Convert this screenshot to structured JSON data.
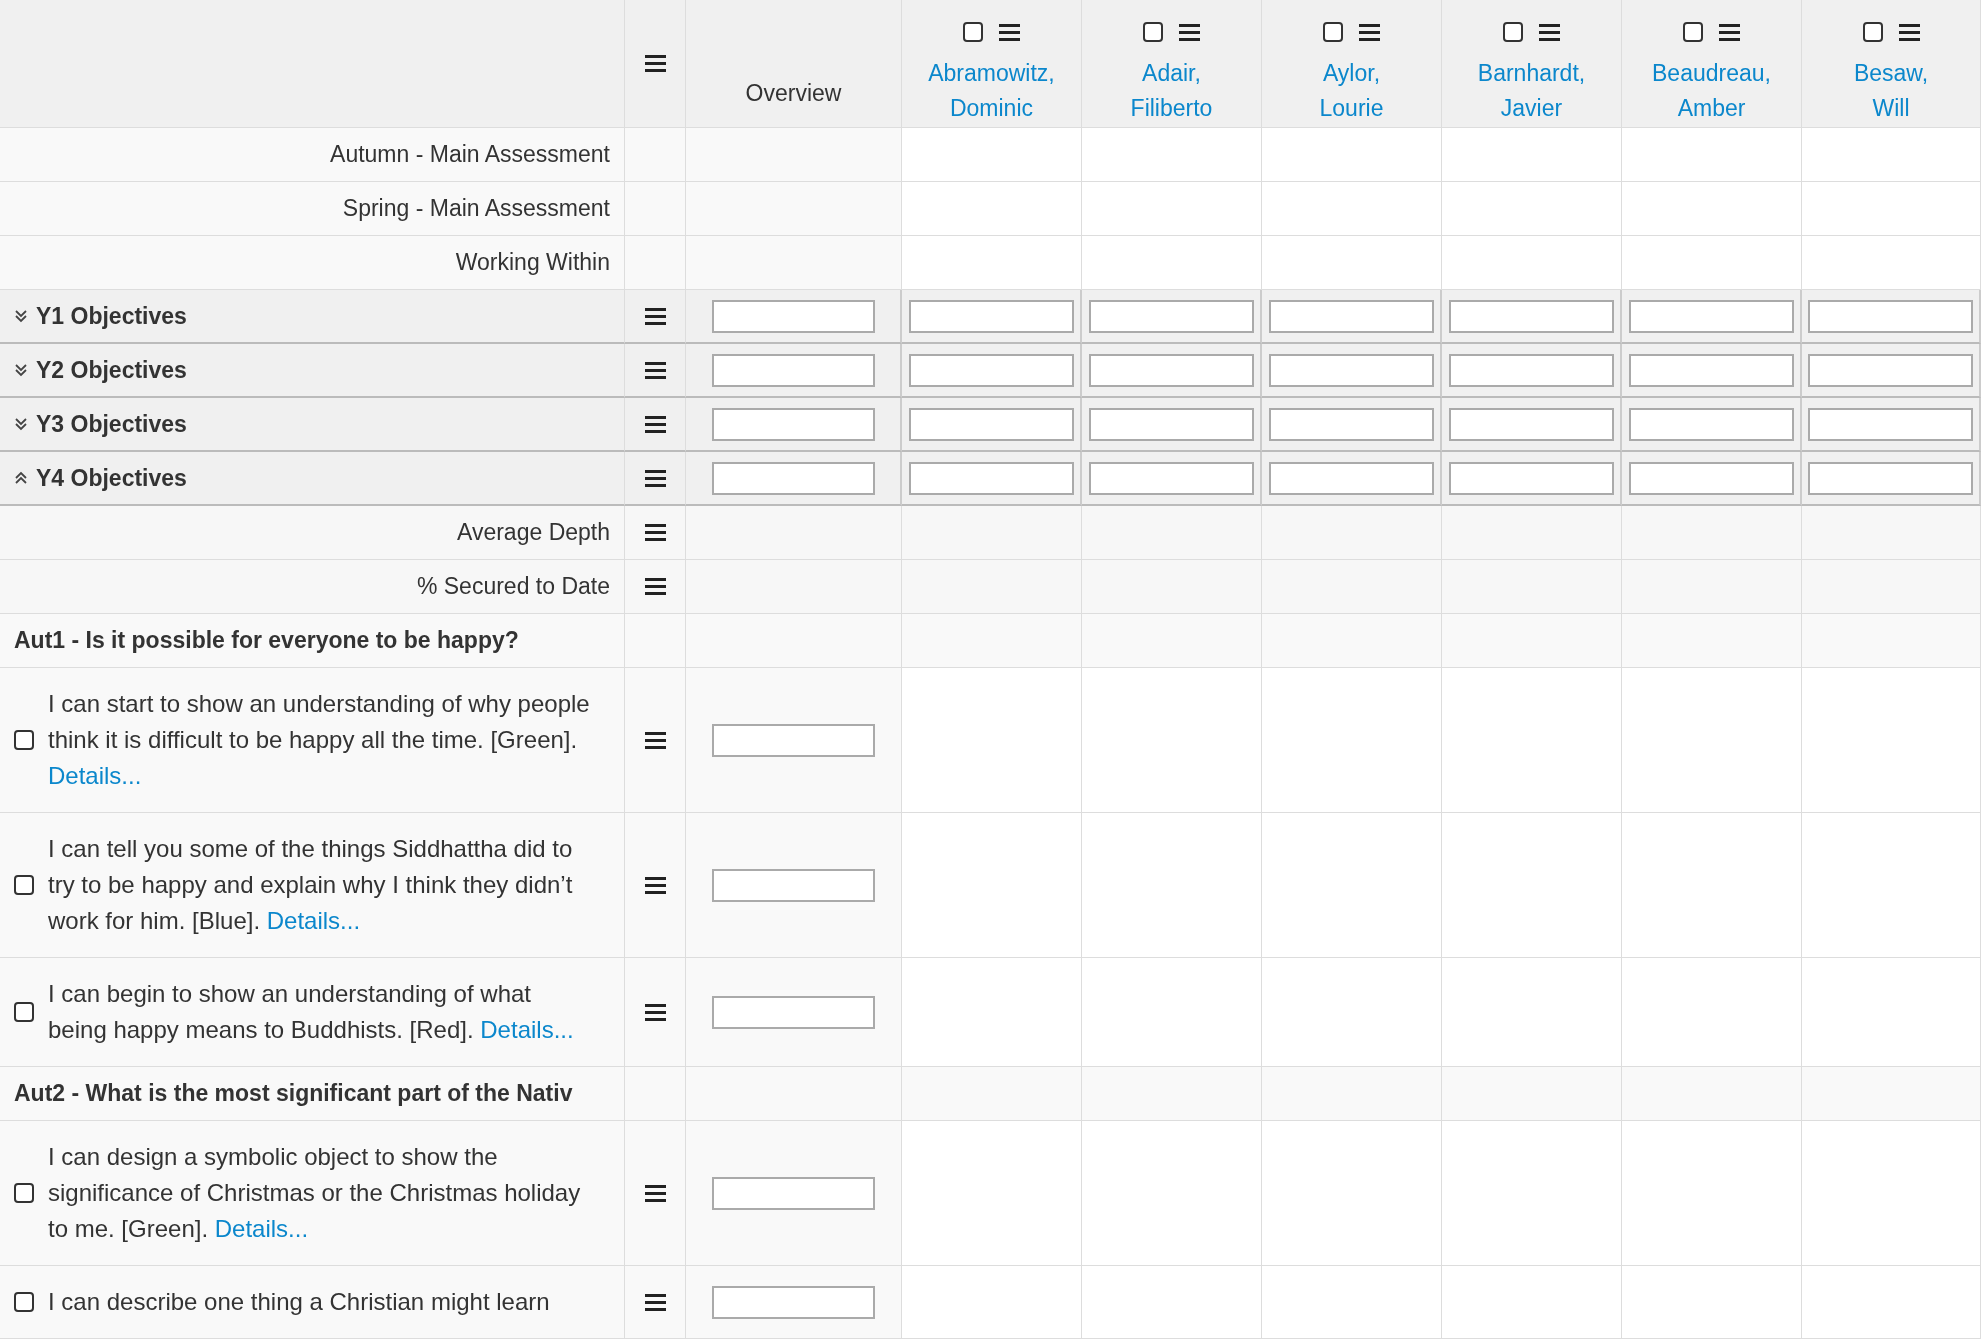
{
  "header": {
    "overview": "Overview",
    "students": [
      {
        "last": "Abramowitz,",
        "first": "Dominic",
        "checked": false
      },
      {
        "last": "Adair,",
        "first": "Filiberto",
        "checked": false
      },
      {
        "last": "Aylor,",
        "first": "Lourie",
        "checked": false
      },
      {
        "last": "Barnhardt,",
        "first": "Javier",
        "checked": false
      },
      {
        "last": "Beaudreau,",
        "first": "Amber",
        "checked": false
      },
      {
        "last": "Besaw,",
        "first": "Will",
        "checked": false
      }
    ]
  },
  "rows": [
    {
      "kind": "assessment",
      "label": "Autumn - Main Assessment"
    },
    {
      "kind": "assessment",
      "label": "Spring - Main Assessment"
    },
    {
      "kind": "assessment",
      "label": "Working Within"
    },
    {
      "kind": "group",
      "label": "Y1 Objectives",
      "expanded": false
    },
    {
      "kind": "group",
      "label": "Y2 Objectives",
      "expanded": false
    },
    {
      "kind": "group",
      "label": "Y3 Objectives",
      "expanded": false
    },
    {
      "kind": "group",
      "label": "Y4 Objectives",
      "expanded": true
    },
    {
      "kind": "summary",
      "label": "Average Depth"
    },
    {
      "kind": "summary",
      "label": "% Secured to Date"
    },
    {
      "kind": "section",
      "label": "Aut1 - Is it possible for everyone to be happy?"
    },
    {
      "kind": "objective",
      "text": "I can start to show an understanding of why people think it is difficult to be happy all the time. [Green].",
      "link": "Details...",
      "checked": false
    },
    {
      "kind": "objective",
      "text": "I can tell you some of the things Siddhattha did to try to be happy and explain why I think they didn’t work for him. [Blue].",
      "link": "Details...",
      "checked": false
    },
    {
      "kind": "objective",
      "text": "I can begin to show an understanding of what being happy means to Buddhists. [Red].",
      "link": "Details...",
      "checked": false
    },
    {
      "kind": "section",
      "label": "Aut2 - What is the most significant part of the Nativ"
    },
    {
      "kind": "objective",
      "text": "I can design a symbolic object to show the significance of Christmas or the Christmas holiday to me. [Green].",
      "link": "Details...",
      "checked": false
    },
    {
      "kind": "objective",
      "text": "I can describe one thing a Christian might learn",
      "checked": false
    }
  ]
}
